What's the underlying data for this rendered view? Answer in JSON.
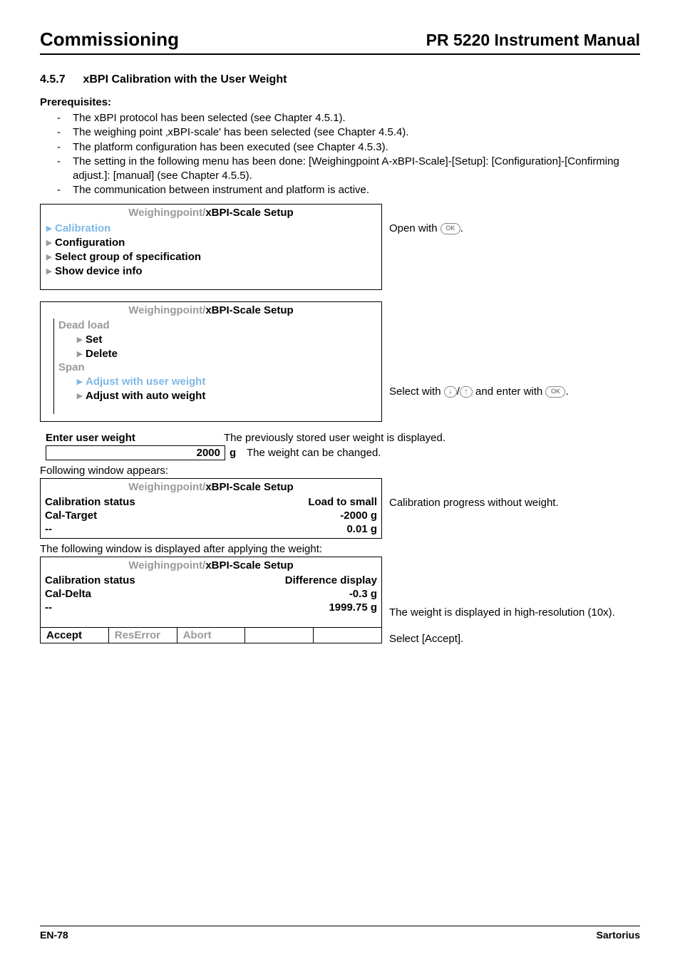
{
  "header": {
    "left": "Commissioning",
    "right": "PR 5220 Instrument Manual"
  },
  "section": {
    "number": "4.5.7",
    "title": "xBPI Calibration with the User Weight"
  },
  "prereq": {
    "heading": "Prerequisites:",
    "items": [
      "The xBPI protocol has been selected (see Chapter 4.5.1).",
      "The weighing point ‚xBPI-scale' has been selected (see Chapter 4.5.4).",
      "The platform configuration has been executed (see Chapter 4.5.3).",
      "The setting in the following menu has been done: [Weighingpoint A-xBPI-Scale]-[Setup]: [Configuration]-[Confirming adjust.]: [manual] (see Chapter 4.5.5).",
      "The communication between instrument and platform is active."
    ]
  },
  "panel1": {
    "title_grey": "Weighingpoint/",
    "title_bold": "xBPI-Scale Setup",
    "items": [
      {
        "label": "Calibration",
        "selected": true
      },
      {
        "label": "Configuration",
        "selected": false
      },
      {
        "label": "Select group of specification",
        "selected": false
      },
      {
        "label": "Show device info",
        "selected": false
      }
    ],
    "note_prefix": "Open with ",
    "note_ok": "OK",
    "note_suffix": "."
  },
  "panel2": {
    "title_grey": "Weighingpoint/",
    "title_bold": "xBPI-Scale Setup",
    "group1": "Dead load",
    "g1_items": [
      {
        "label": "Set",
        "selected": false
      },
      {
        "label": "Delete",
        "selected": false
      }
    ],
    "group2": "Span",
    "g2_items": [
      {
        "label": "Adjust with user weight",
        "selected": true
      },
      {
        "label": "Adjust with auto weight",
        "selected": false
      }
    ],
    "note_prefix": "Select with ",
    "note_mid": " and enter with ",
    "note_ok": "OK",
    "note_suffix": "."
  },
  "enter": {
    "label": "Enter user weight",
    "desc": "The previously stored user weight is displayed.",
    "value": "2000",
    "unit": "g",
    "value_note": "The weight can be changed."
  },
  "following": "Following window appears:",
  "panel3": {
    "title_grey": "Weighingpoint/",
    "title_bold": "xBPI-Scale Setup",
    "rows": [
      {
        "l": "Calibration status",
        "r": "Load to small",
        "note": "Calibration progress without weight."
      },
      {
        "l": "Cal-Target",
        "r": "-2000 g",
        "note": ""
      },
      {
        "l": "--",
        "r": "0.01 g",
        "note": ""
      }
    ]
  },
  "after_apply": "The following window is displayed after applying the weight:",
  "panel4": {
    "title_grey": "Weighingpoint/",
    "title_bold": "xBPI-Scale Setup",
    "rows": [
      {
        "l": "Calibration status",
        "r": "Difference display",
        "note": ""
      },
      {
        "l": "Cal-Delta",
        "r": "-0.3 g",
        "note": ""
      },
      {
        "l": "--",
        "r": "1999.75 g",
        "note": "The weight is displayed in high-resolution (10x)."
      }
    ],
    "softkeys": [
      {
        "label": "Accept",
        "active": true
      },
      {
        "label": "ResError",
        "active": false
      },
      {
        "label": "Abort",
        "active": false
      },
      {
        "label": "",
        "active": false
      },
      {
        "label": "",
        "active": false
      }
    ],
    "soft_note": "Select [Accept]."
  },
  "footer": {
    "left": "EN-78",
    "right": "Sartorius"
  }
}
